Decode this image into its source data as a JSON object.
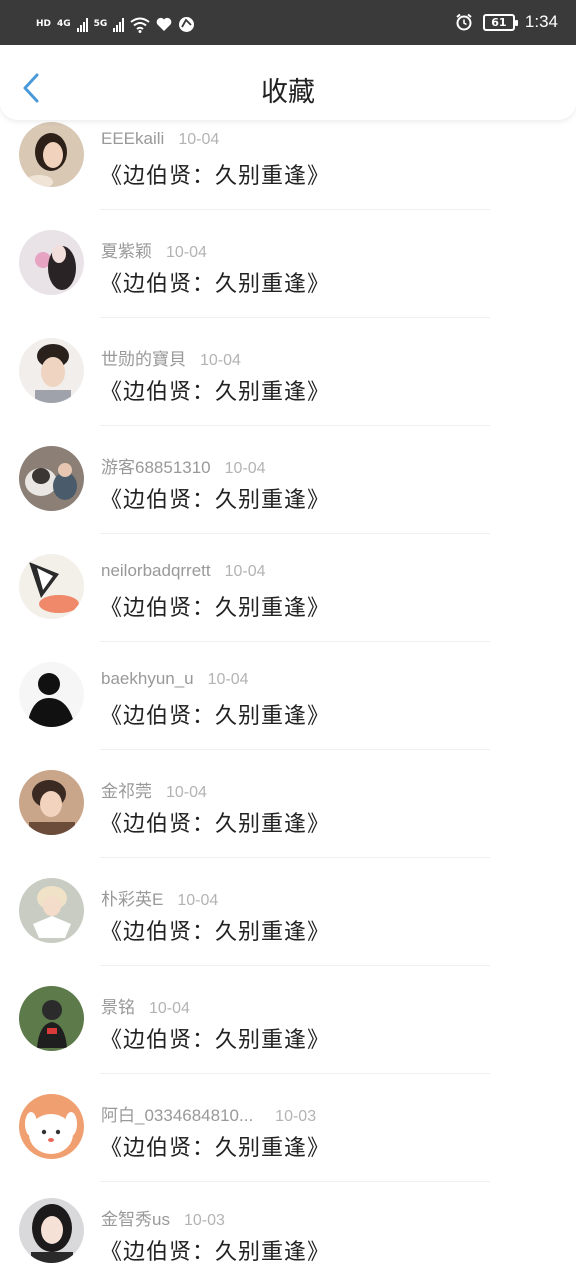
{
  "status_bar": {
    "left_label_1": "HD",
    "net_1": "4G",
    "net_2": "5G",
    "battery": "61",
    "time": "1:34"
  },
  "header": {
    "title": "收藏",
    "back_icon": "chevron-left-icon"
  },
  "colors": {
    "accent": "#4a9ad8",
    "status_bar_bg": "#3a3a3a",
    "meta_text": "#999999"
  },
  "items": [
    {
      "user": "EEEkaili",
      "date": "10-04",
      "title": "《边伯贤：久别重逢》"
    },
    {
      "user": "夏紫颖",
      "date": "10-04",
      "title": "《边伯贤：久别重逢》"
    },
    {
      "user": "世勋的寶貝",
      "date": "10-04",
      "title": "《边伯贤：久别重逢》"
    },
    {
      "user": "游客68851310",
      "date": "10-04",
      "title": "《边伯贤：久别重逢》"
    },
    {
      "user": "neilorbadqrrett",
      "date": "10-04",
      "title": "《边伯贤：久别重逢》"
    },
    {
      "user": "baekhyun_u",
      "date": "10-04",
      "title": "《边伯贤：久别重逢》"
    },
    {
      "user": "金祁莞",
      "date": "10-04",
      "title": "《边伯贤：久别重逢》"
    },
    {
      "user": "朴彩英E",
      "date": "10-04",
      "title": "《边伯贤：久别重逢》"
    },
    {
      "user": "景铭",
      "date": "10-04",
      "title": "《边伯贤：久别重逢》"
    },
    {
      "user": "阿白_0334684810...",
      "date": "10-03",
      "title": "《边伯贤：久别重逢》"
    },
    {
      "user": "金智秀us",
      "date": "10-03",
      "title": "《边伯贤：久别重逢》"
    }
  ]
}
